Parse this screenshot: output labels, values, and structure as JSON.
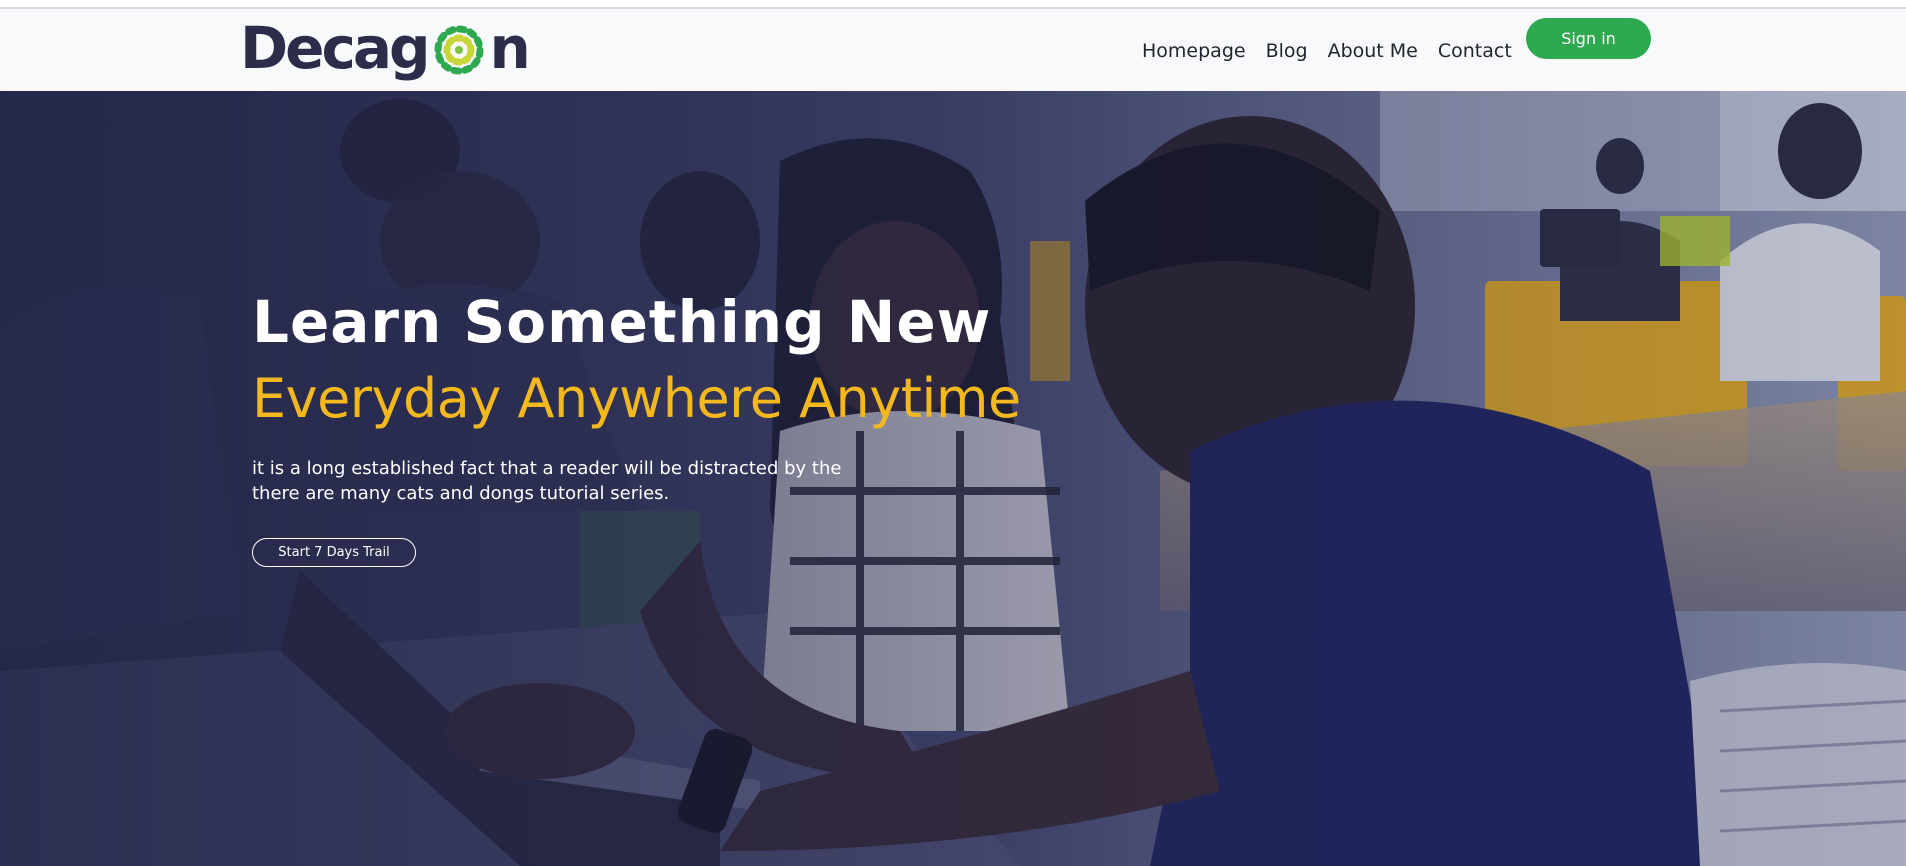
{
  "brand": {
    "logo_text_left": "Decag",
    "logo_text_right": "n"
  },
  "nav": {
    "links": [
      {
        "label": "Homepage"
      },
      {
        "label": "Blog"
      },
      {
        "label": "About Me"
      },
      {
        "label": "Contact"
      }
    ],
    "signin_label": "Sign in"
  },
  "hero": {
    "title": "Learn Something New",
    "subtitle": "Everyday Anywhere Anytime",
    "description": "it is a long established fact that a reader will be distracted by the there are many cats and dongs tutorial series.",
    "cta_label": "Start 7 Days Trail"
  },
  "colors": {
    "accent_green": "#2ea94f",
    "accent_yellow": "#f2b81d",
    "brand_navy": "#2b2d4a",
    "overlay": "#212344"
  },
  "icons": {
    "logo_mark": "dotted-ring-icon"
  }
}
